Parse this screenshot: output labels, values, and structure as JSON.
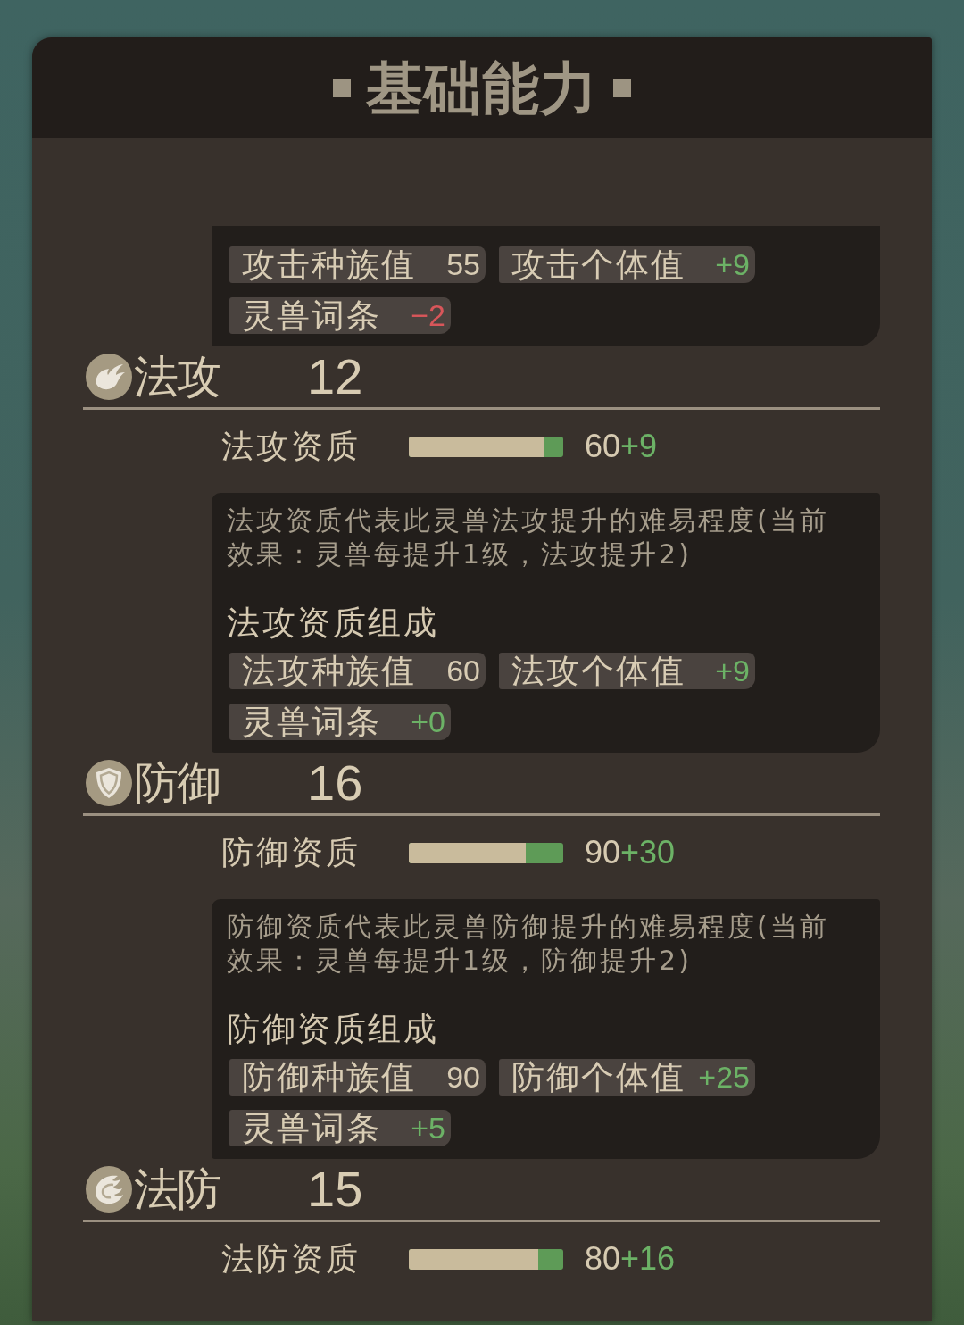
{
  "header": {
    "title": "基础能力"
  },
  "top_details": {
    "chips": [
      {
        "label": "攻击种族值",
        "value": "55",
        "kind": "base"
      },
      {
        "label": "攻击个体值",
        "value": "+9",
        "kind": "gain"
      },
      {
        "label": "灵兽词条",
        "value": "−2",
        "kind": "loss"
      }
    ]
  },
  "stats": [
    {
      "name": "法攻",
      "value": "12",
      "aptitude": {
        "label": "法攻资质",
        "level": 0.88,
        "base": "60",
        "bonus": "+9"
      },
      "details": {
        "description": "法攻资质代表此灵兽法攻提升的难易程度(当前效果：灵兽每提升1级，法攻提升2)",
        "heading": "法攻资质组成",
        "chips": [
          {
            "label": "法攻种族值",
            "value": "60",
            "kind": "base"
          },
          {
            "label": "法攻个体值",
            "value": "+9",
            "kind": "gain"
          },
          {
            "label": "灵兽词条",
            "value": "+0",
            "kind": "gain"
          }
        ]
      }
    },
    {
      "name": "防御",
      "value": "16",
      "aptitude": {
        "label": "防御资质",
        "level": 0.76,
        "base": "90",
        "bonus": "+30"
      },
      "details": {
        "description": "防御资质代表此灵兽防御提升的难易程度(当前效果：灵兽每提升1级，防御提升2)",
        "heading": "防御资质组成",
        "chips": [
          {
            "label": "防御种族值",
            "value": "90",
            "kind": "base"
          },
          {
            "label": "防御个体值",
            "value": "+25",
            "kind": "gain"
          },
          {
            "label": "灵兽词条",
            "value": "+5",
            "kind": "gain"
          }
        ]
      }
    },
    {
      "name": "法防",
      "value": "15",
      "aptitude": {
        "label": "法防资质",
        "level": 0.84,
        "base": "80",
        "bonus": "+16"
      }
    }
  ]
}
